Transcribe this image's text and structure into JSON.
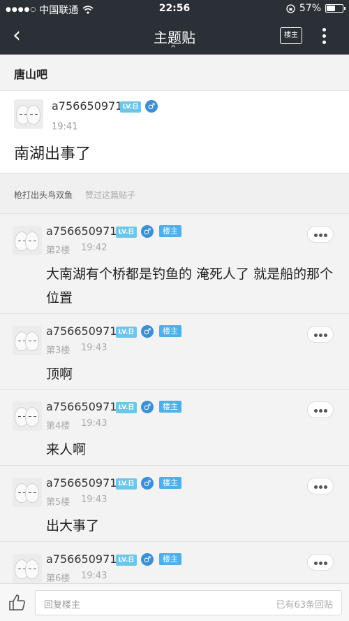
{
  "status": {
    "signal_dots": "●●●●○",
    "carrier": "中国联通",
    "wifi_icon": "wifi-icon",
    "time": "22:56",
    "battery": "57%",
    "battery_level": 0.57
  },
  "nav": {
    "back_icon": "‹",
    "title": "主题贴",
    "caret": "^",
    "host_only_label": "楼主",
    "more_icon": "more-vertical-icon"
  },
  "forum": {
    "name": "唐山吧"
  },
  "op": {
    "username": "a756650971",
    "level": "LV.日",
    "gender": "♂",
    "time": "19:41",
    "content": "南湖出事了"
  },
  "likes": {
    "names": "枪打出头鸟双鱼",
    "suffix": "赞过这篇贴子"
  },
  "replies": [
    {
      "username": "a756650971",
      "level": "LV.日",
      "gender": "♂",
      "badge": "楼主",
      "floor": "第2楼",
      "time": "19:42",
      "content": "大南湖有个桥都是钓鱼的 淹死人了 就是船的那个位置"
    },
    {
      "username": "a756650971",
      "level": "LV.日",
      "gender": "♂",
      "badge": "楼主",
      "floor": "第3楼",
      "time": "19:43",
      "content": "顶啊"
    },
    {
      "username": "a756650971",
      "level": "LV.日",
      "gender": "♂",
      "badge": "楼主",
      "floor": "第4楼",
      "time": "19:43",
      "content": "来人啊"
    },
    {
      "username": "a756650971",
      "level": "LV.日",
      "gender": "♂",
      "badge": "楼主",
      "floor": "第5楼",
      "time": "19:43",
      "content": "出大事了"
    },
    {
      "username": "a756650971",
      "level": "LV.日",
      "gender": "♂",
      "badge": "楼主",
      "floor": "第6楼",
      "time": "19:43",
      "content": ""
    }
  ],
  "bottom": {
    "placeholder": "回复楼主",
    "count": "已有63条回贴"
  }
}
